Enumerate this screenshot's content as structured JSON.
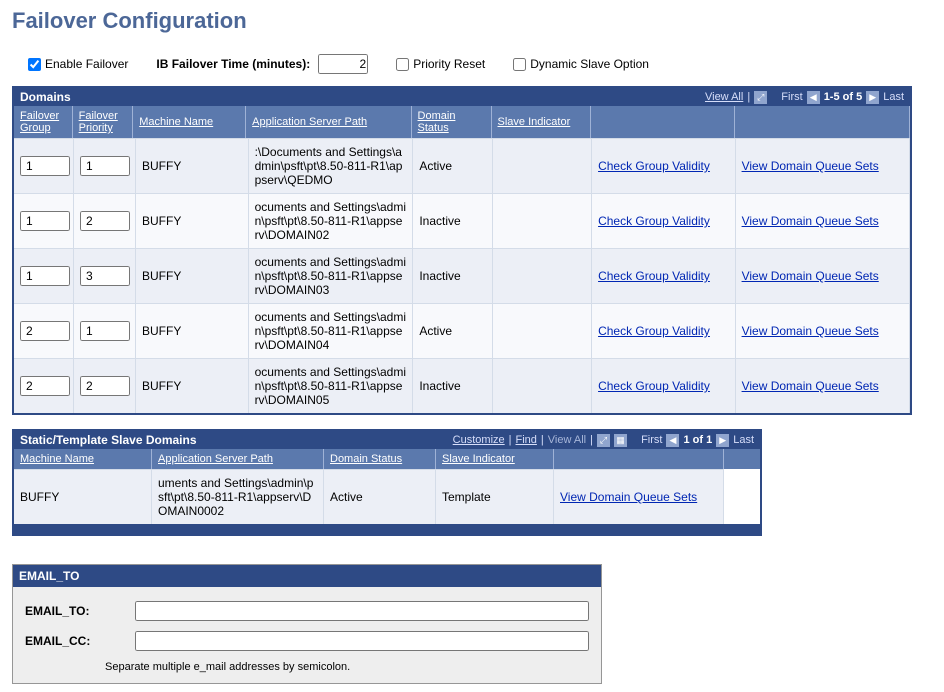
{
  "page_title": "Failover Configuration",
  "options": {
    "enable_failover_label": "Enable Failover",
    "enable_failover_checked": true,
    "time_label": "IB Failover Time (minutes):",
    "time_value": "2",
    "priority_reset_label": "Priority Reset",
    "priority_reset_checked": false,
    "dynamic_slave_label": "Dynamic Slave Option",
    "dynamic_slave_checked": false
  },
  "domains_grid": {
    "title": "Domains",
    "nav": {
      "view_all": "View All",
      "first": "First",
      "range": "1-5 of 5",
      "last": "Last"
    },
    "columns": {
      "failover_group": "Failover Group",
      "failover_priority": "Failover Priority",
      "machine_name": "Machine Name",
      "app_server_path": "Application Server Path",
      "domain_status": "Domain Status",
      "slave_indicator": "Slave Indicator",
      "check_group_validity": "Check Group Validity",
      "view_domain_queue_sets": "View Domain Queue Sets"
    },
    "rows": [
      {
        "group": "1",
        "priority": "1",
        "machine": "BUFFY",
        "path": ":\\Documents and Settings\\admin\\psft\\pt\\8.50-811-R1\\appserv\\QEDMO",
        "status": "Active",
        "slave": ""
      },
      {
        "group": "1",
        "priority": "2",
        "machine": "BUFFY",
        "path": "ocuments and Settings\\admin\\psft\\pt\\8.50-811-R1\\appserv\\DOMAIN02",
        "status": "Inactive",
        "slave": ""
      },
      {
        "group": "1",
        "priority": "3",
        "machine": "BUFFY",
        "path": "ocuments and Settings\\admin\\psft\\pt\\8.50-811-R1\\appserv\\DOMAIN03",
        "status": "Inactive",
        "slave": ""
      },
      {
        "group": "2",
        "priority": "1",
        "machine": "BUFFY",
        "path": "ocuments and Settings\\admin\\psft\\pt\\8.50-811-R1\\appserv\\DOMAIN04",
        "status": "Active",
        "slave": ""
      },
      {
        "group": "2",
        "priority": "2",
        "machine": "BUFFY",
        "path": "ocuments and Settings\\admin\\psft\\pt\\8.50-811-R1\\appserv\\DOMAIN05",
        "status": "Inactive",
        "slave": ""
      }
    ]
  },
  "slave_grid": {
    "title": "Static/Template Slave Domains",
    "nav": {
      "customize": "Customize",
      "find": "Find",
      "view_all": "View All",
      "first": "First",
      "range": "1 of 1",
      "last": "Last"
    },
    "columns": {
      "machine_name": "Machine Name",
      "app_server_path": "Application Server Path",
      "domain_status": "Domain Status",
      "slave_indicator": "Slave Indicator",
      "view_domain_queue_sets": "View Domain Queue Sets"
    },
    "rows": [
      {
        "machine": "BUFFY",
        "path": "uments and Settings\\admin\\psft\\pt\\8.50-811-R1\\appserv\\DOMAIN0002",
        "status": "Active",
        "slave": "Template"
      }
    ]
  },
  "email": {
    "header": "EMAIL_TO",
    "to_label": "EMAIL_TO:",
    "to_value": "",
    "cc_label": "EMAIL_CC:",
    "cc_value": "",
    "note": "Separate multiple e_mail addresses by semicolon."
  }
}
